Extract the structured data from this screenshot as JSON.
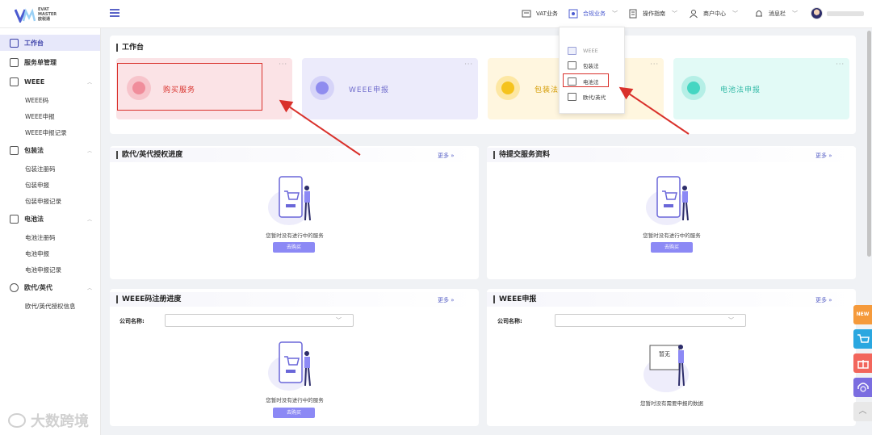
{
  "brand": {
    "logo_line1": "EVAT",
    "logo_line2": "MASTER",
    "logo_line3": "欧税通"
  },
  "topnav": {
    "vat": "VAT业务",
    "compliance": "合规业务",
    "guide": "操作指南",
    "merchant": "商户中心",
    "messages": "消息栏"
  },
  "sidebar": {
    "workbench": "工作台",
    "orders": "服务单管理",
    "weee": {
      "label": "WEEE",
      "items": [
        "WEEE码",
        "WEEE申报",
        "WEEE申报记录"
      ]
    },
    "packaging": {
      "label": "包装法",
      "items": [
        "包装注册码",
        "包装申报",
        "包装申报记录"
      ]
    },
    "battery": {
      "label": "电池法",
      "items": [
        "电池注册码",
        "电池申报",
        "电池申报记录"
      ]
    },
    "rep": {
      "label": "欧代/英代",
      "items": [
        "欧代/英代授权信息"
      ]
    }
  },
  "workbench": {
    "title": "工作台",
    "tiles": [
      {
        "label": "购买服务",
        "color": "#fbe3e6",
        "accent": "#f08d9b"
      },
      {
        "label": "WEEE申报",
        "color": "#ecebfb",
        "accent": "#8f8cef"
      },
      {
        "label": "包装法申报",
        "color": "#fff6df",
        "accent": "#f5c31d"
      },
      {
        "label": "电池法申报",
        "color": "#e2faf6",
        "accent": "#45d6c2"
      }
    ],
    "tile_more": "···"
  },
  "dropdown": {
    "items": [
      "WEEE",
      "包装法",
      "电池法",
      "欧代/英代"
    ]
  },
  "panels": {
    "rep_progress": {
      "title": "欧代/英代授权进度",
      "more": "更多 »",
      "empty": "您暂时没有进行中的服务",
      "button": "去购买"
    },
    "pending_docs": {
      "title": "待提交服务资料",
      "more": "更多 »",
      "empty": "您暂时没有进行中的服务",
      "button": "去购买"
    },
    "weee_reg": {
      "title": "WEEE码注册进度",
      "more": "更多 »",
      "company_label": "公司名称:",
      "empty": "您暂时没有进行中的服务",
      "button": "去购买"
    },
    "weee_decl": {
      "title": "WEEE申报",
      "more": "更多 »",
      "company_label": "公司名称:",
      "empty": "您暂时没有需要申报的数据",
      "board_text": "暂无"
    }
  },
  "float": {
    "new_badge": "NEW"
  },
  "watermark": "大数跨境",
  "colors": {
    "primary": "#5a63c7",
    "highlight": "#d9312b",
    "button": "#8c89f5"
  }
}
